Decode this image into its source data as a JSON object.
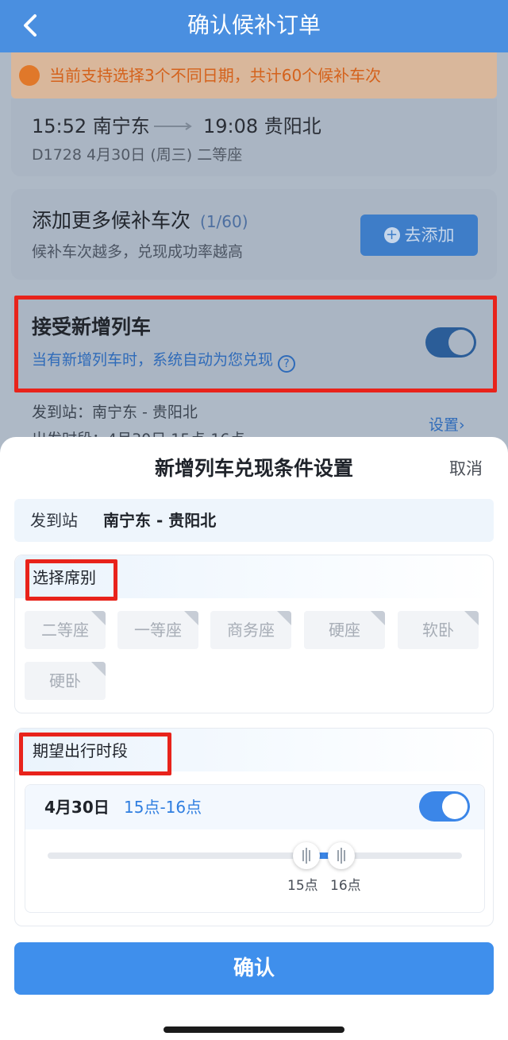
{
  "nav": {
    "title": "确认候补订单"
  },
  "notice": {
    "text": "当前支持选择3个不同日期，共计60个候补车次"
  },
  "trip": {
    "depart_time_station": "15:52 南宁东",
    "arrive_time_station": "19:08 贵阳北",
    "meta": "D1728   4月30日 (周三) 二等座"
  },
  "add_more": {
    "title": "添加更多候补车次",
    "count": "(1/60)",
    "subtitle": "候补车次越多，兑现成功率越高",
    "button_label": "去添加"
  },
  "accept_new": {
    "title": "接受新增列车",
    "subtitle": "当有新增列车时，系统自动为您兑现",
    "help": "?",
    "enabled": true
  },
  "background_details": {
    "stations": "发到站：南宁东 - 贵阳北",
    "depart_period": "出发时段：4月30日 15点-16点",
    "settings_link": "设置›"
  },
  "sheet": {
    "title": "新增列车兑现条件设置",
    "cancel_label": "取消",
    "route_label": "发到站",
    "route_value": "南宁东 - 贵阳北",
    "seat_section_title": "选择席别",
    "seats": [
      {
        "label": "二等座"
      },
      {
        "label": "一等座"
      },
      {
        "label": "商务座"
      },
      {
        "label": "硬座"
      },
      {
        "label": "软卧"
      },
      {
        "label": "硬卧"
      }
    ],
    "time_section_title": "期望出行时段",
    "date": "4月30日",
    "time_range": "15点-16点",
    "date_enabled": true,
    "slider": {
      "start_label": "15点",
      "end_label": "16点"
    },
    "confirm_label": "确认"
  },
  "colors": {
    "primary": "#3f8fec",
    "nav": "#4a8fe0",
    "highlight_box": "#e8231b",
    "notice_text": "#d4621c"
  }
}
